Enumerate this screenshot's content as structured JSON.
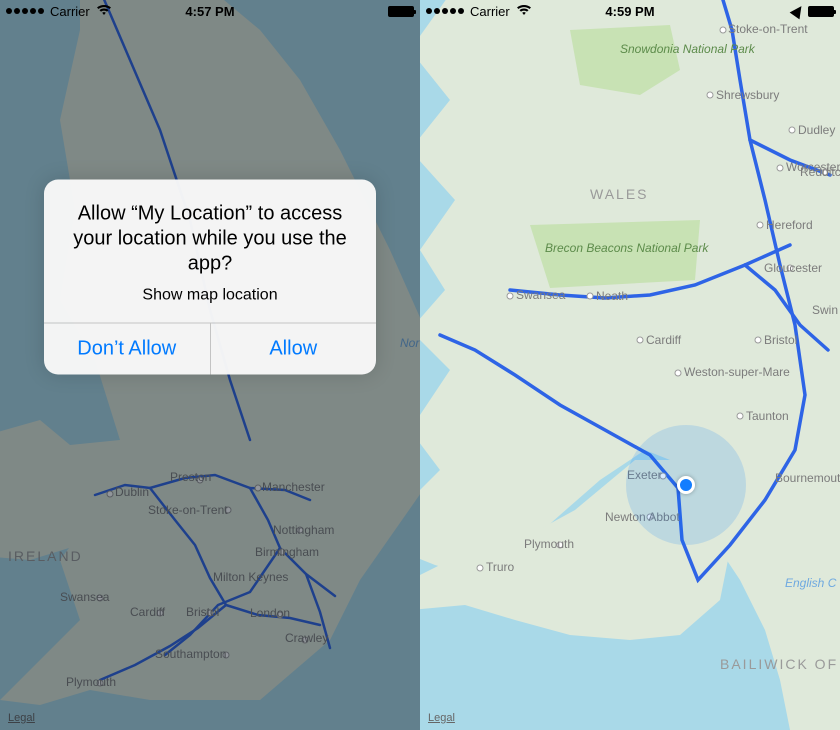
{
  "left": {
    "status": {
      "carrier": "Carrier",
      "time": "4:57 PM"
    },
    "alert": {
      "title": "Allow “My Location” to access your location while you use the app?",
      "message": "Show map location",
      "deny": "Don’t Allow",
      "allow": "Allow"
    },
    "labels": {
      "ireland": "IRELAND",
      "dublin": "Dublin",
      "preston": "Preston",
      "stoke": "Stoke-on-Trent",
      "manchester": "Manchester",
      "nottingham": "Nottingham",
      "birmingham": "Birmingham",
      "milton": "Milton Keynes",
      "swansea": "Swansea",
      "cardiff": "Cardiff",
      "bristol": "Bristol",
      "london": "London",
      "crawley": "Crawley",
      "southampton": "Southampton",
      "plymouth": "Plymouth",
      "nor": "Nor"
    },
    "legal": "Legal"
  },
  "right": {
    "status": {
      "carrier": "Carrier",
      "time": "4:59 PM"
    },
    "labels": {
      "snowdonia": "Snowdonia National Park",
      "wales": "WALES",
      "brecon": "Brecon Beacons National Park",
      "shrewsbury": "Shrewsbury",
      "stoke": "Stoke-on-Trent",
      "dudley": "Dudley",
      "worcester": "Worcester",
      "redditch": "Redditc",
      "hereford": "Hereford",
      "swansea": "Swansea",
      "neath": "Neath",
      "cardiff": "Cardiff",
      "gloucester": "Gloucester",
      "swin": "Swin",
      "bristol": "Bristol",
      "weston": "Weston-super-Mare",
      "taunton": "Taunton",
      "exeter": "Exeter",
      "bournemouth": "Bournemout",
      "newton": "Newton Abbot",
      "plymouth": "Plymouth",
      "truro": "Truro",
      "english": "English C",
      "guernsey": "BAILIWICK OF GUERNSEY"
    },
    "legal": "Legal"
  }
}
